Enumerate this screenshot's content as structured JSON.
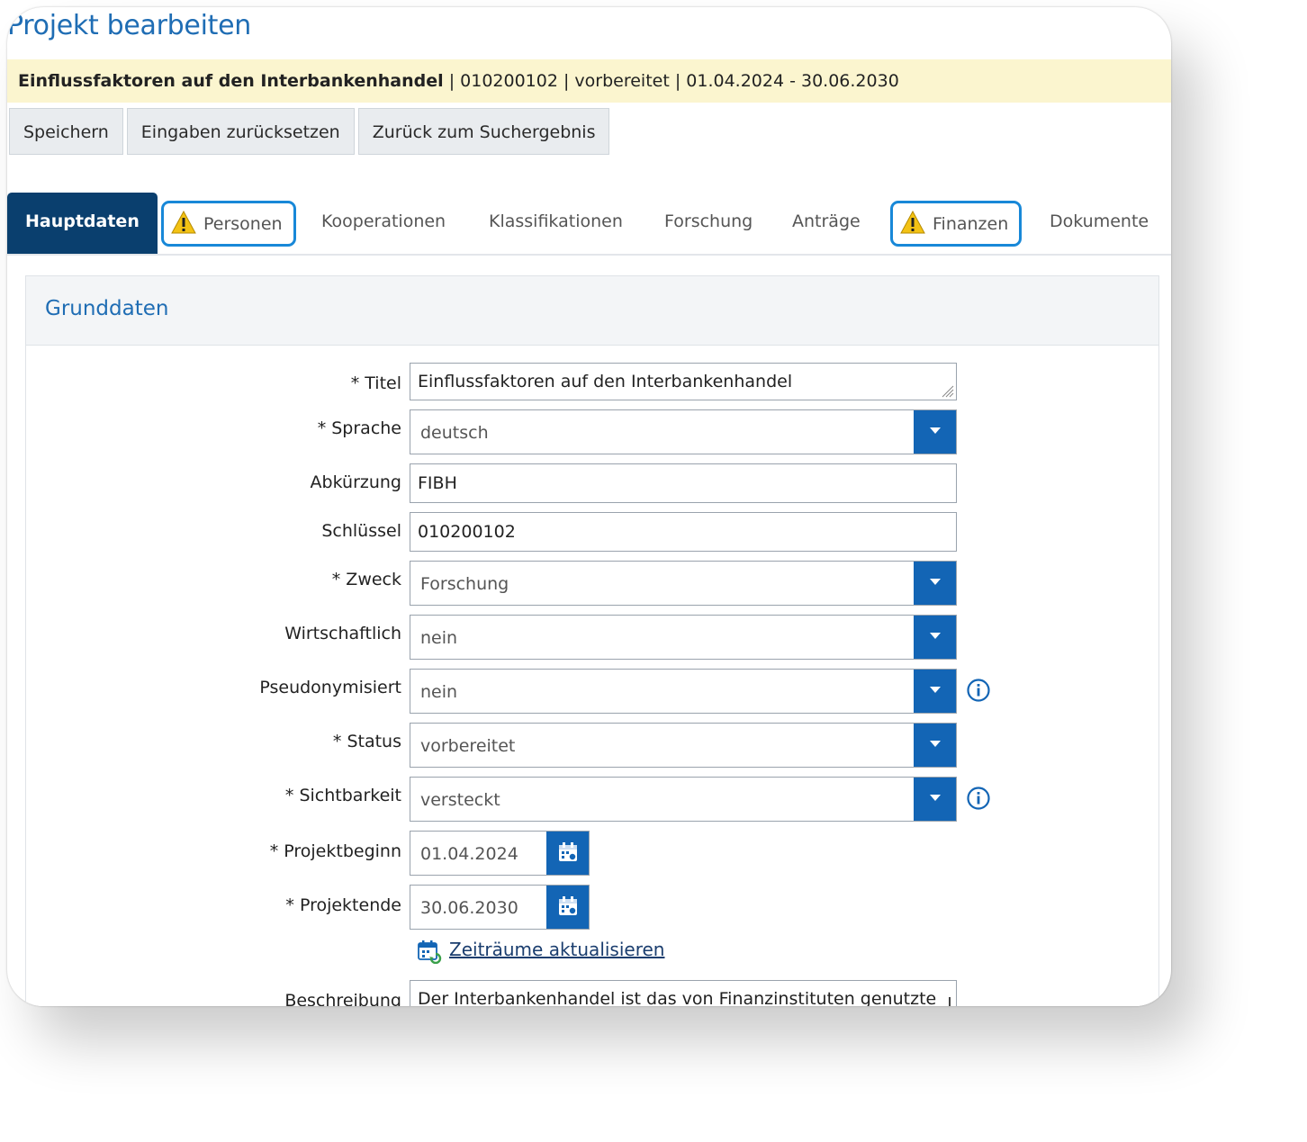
{
  "page": {
    "title": "Projekt bearbeiten"
  },
  "info_bar": {
    "project_title": "Einflussfaktoren auf den Interbankenhandel",
    "rest": " | 010200102 | vorbereitet | 01.04.2024 - 30.06.2030"
  },
  "toolbar": {
    "save": "Speichern",
    "reset": "Eingaben zurücksetzen",
    "back": "Zurück zum Suchergebnis"
  },
  "tabs": [
    {
      "label": "Hauptdaten",
      "active": true,
      "warning": false
    },
    {
      "label": "Personen",
      "active": false,
      "warning": true
    },
    {
      "label": "Kooperationen",
      "active": false,
      "warning": false
    },
    {
      "label": "Klassifikationen",
      "active": false,
      "warning": false
    },
    {
      "label": "Forschung",
      "active": false,
      "warning": false
    },
    {
      "label": "Anträge",
      "active": false,
      "warning": false
    },
    {
      "label": "Finanzen",
      "active": false,
      "warning": true
    },
    {
      "label": "Dokumente",
      "active": false,
      "warning": false
    }
  ],
  "section": {
    "title": "Grunddaten"
  },
  "form": {
    "titel": {
      "label": "* Titel",
      "value": "Einflussfaktoren auf den Interbankenhandel"
    },
    "sprache": {
      "label": "* Sprache",
      "value": "deutsch"
    },
    "abkuerzung": {
      "label": "Abkürzung",
      "value": "FIBH"
    },
    "schluessel": {
      "label": "Schlüssel",
      "value": "010200102"
    },
    "zweck": {
      "label": "* Zweck",
      "value": "Forschung"
    },
    "wirtschaftlich": {
      "label": "Wirtschaftlich",
      "value": "nein"
    },
    "pseudonymisiert": {
      "label": "Pseudonymisiert",
      "value": "nein"
    },
    "status": {
      "label": "* Status",
      "value": "vorbereitet"
    },
    "sichtbarkeit": {
      "label": "* Sichtbarkeit",
      "value": "versteckt"
    },
    "projektbeginn": {
      "label": "* Projektbeginn",
      "value": "01.04.2024"
    },
    "projektende": {
      "label": "* Projektende",
      "value": "30.06.2030"
    },
    "zeitraeume_link": "Zeiträume aktualisieren",
    "beschreibung": {
      "label": "Beschreibung",
      "value": "Der Interbankenhandel ist das von Finanzinstituten genutzte"
    }
  },
  "colors": {
    "accent": "#1365b5",
    "active_tab": "#0a3f6e",
    "info_bar_bg": "#fbf5cf",
    "warning_outline": "#1888d8",
    "title_blue": "#1f6db4"
  },
  "icons": {
    "warning": "warning-icon",
    "dropdown": "chevron-down-icon",
    "calendar": "calendar-icon",
    "info": "info-icon"
  }
}
